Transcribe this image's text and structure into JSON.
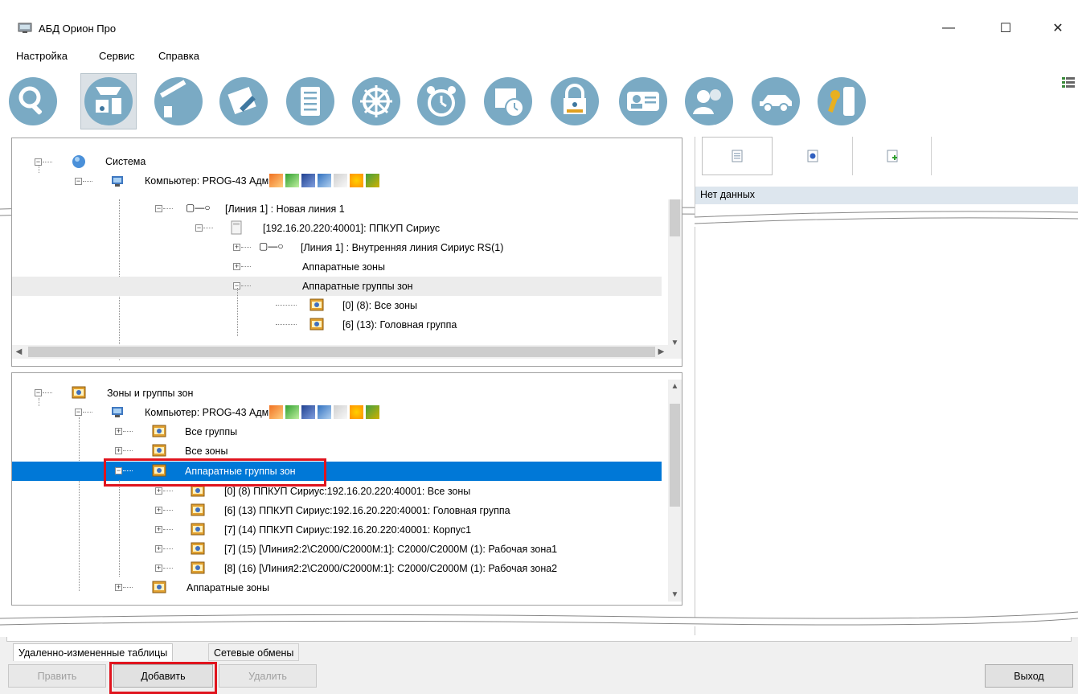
{
  "window": {
    "title": "АБД Орион Про",
    "minimize": "—",
    "maximize": "☐",
    "close": "✕"
  },
  "menu": [
    "Настройка",
    "Сервис",
    "Справка"
  ],
  "toolbar_icons": [
    "search-icon",
    "device-icon",
    "barrier-icon",
    "map-edit-icon",
    "document-icon",
    "wheel-icon",
    "alarm-clock-icon",
    "schedule-icon",
    "lock-icon",
    "user-card-icon",
    "people-icon",
    "car-icon",
    "key-icon"
  ],
  "top_tree": {
    "root": "Система",
    "computer": "Компьютер: PROG-43 Админ",
    "line1": "[Линия 1] : Новая линия 1",
    "device": "[192.16.20.220:40001]: ППКУП Сириус",
    "internal_line": "[Линия 1] : Внутренняя линия Сириус RS(1)",
    "hw_zones": "Аппаратные зоны",
    "hw_groups": "Аппаратные группы зон",
    "group0": "[0] (8): Все зоны",
    "group6": "[6] (13): Головная группа"
  },
  "bottom_tree": {
    "root": "Зоны и группы зон",
    "computer": "Компьютер: PROG-43 Админ",
    "all_groups": "Все группы",
    "all_zones": "Все зоны",
    "hw_groups": "Аппаратные группы зон",
    "items": [
      "[0] (8) ППКУП Сириус:192.16.20.220:40001: Все зоны",
      "[6] (13) ППКУП Сириус:192.16.20.220:40001: Головная группа",
      "[7] (14) ППКУП Сириус:192.16.20.220:40001: Корпус1",
      "[7] (15) [\\Линия2:2\\C2000/C2000M:1]: C2000/C2000M (1): Рабочая зона1",
      "[8] (16) [\\Линия2:2\\C2000/C2000M:1]: C2000/C2000M (1): Рабочая зона2"
    ],
    "hw_zones": "Аппаратные зоны"
  },
  "right_panel": {
    "no_data": "Нет данных"
  },
  "bottom": {
    "tabs": [
      "Удаленно-измененные таблицы",
      "Сетевые обмены"
    ],
    "buttons": {
      "edit": "Править",
      "add": "Добавить",
      "delete": "Удалить",
      "exit": "Выход"
    }
  },
  "colors": {
    "selection": "#0078d7",
    "highlight": "#e0141e",
    "toolbar_circle": "#7aaac4"
  }
}
